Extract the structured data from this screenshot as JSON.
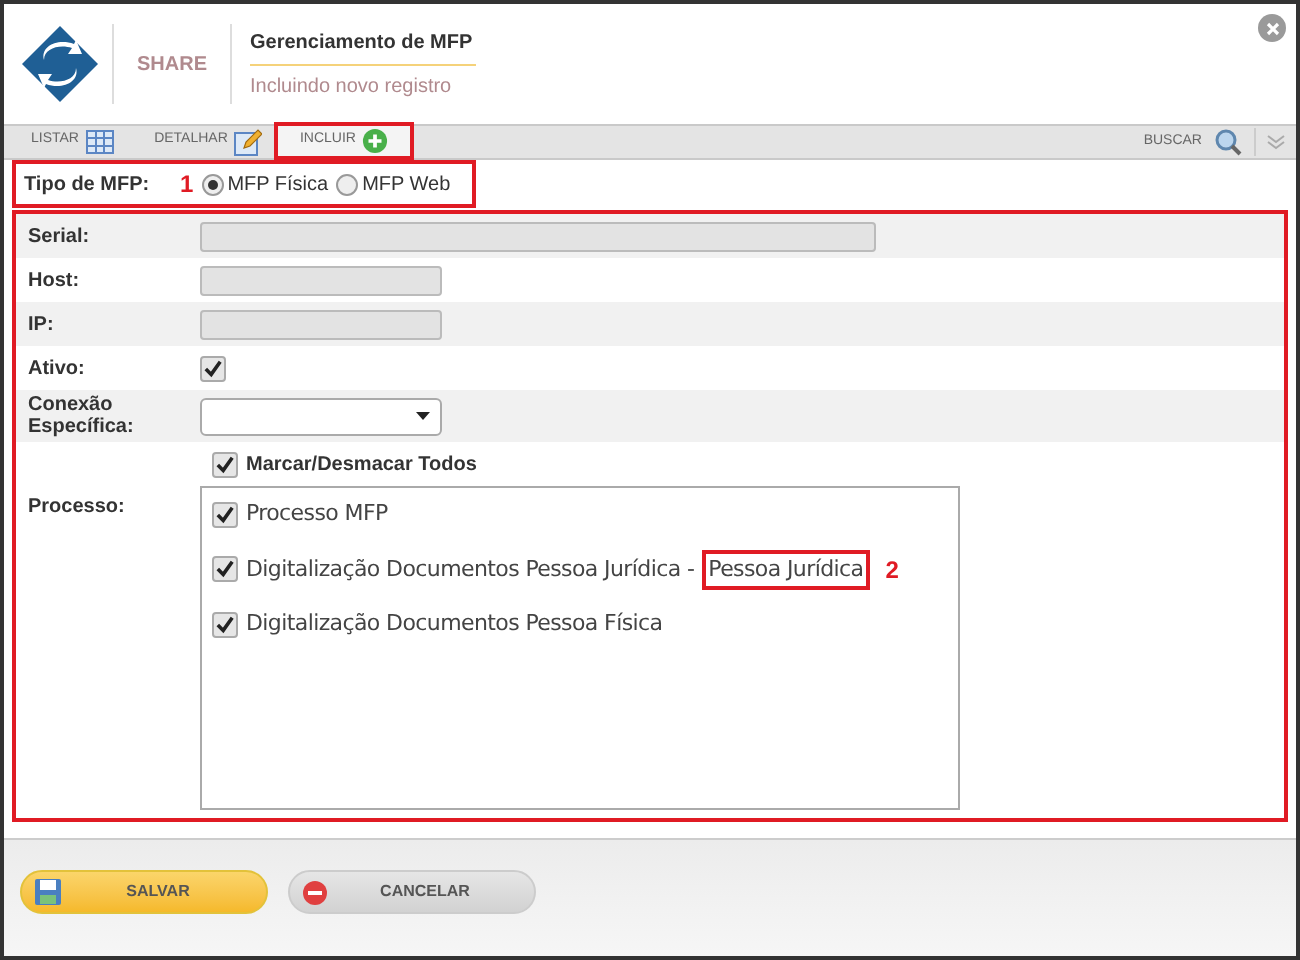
{
  "header": {
    "brand": "SHARE",
    "title": "Gerenciamento de MFP",
    "subtitle": "Incluindo novo registro"
  },
  "tabs": [
    {
      "label": "LISTAR",
      "selected": false
    },
    {
      "label": "DETALHAR",
      "selected": false
    },
    {
      "label": "INCLUIR",
      "selected": true
    }
  ],
  "search_label": "BUSCAR",
  "mfp_type": {
    "label": "Tipo de MFP:",
    "marker": "1",
    "options": [
      {
        "label": "MFP Física",
        "selected": true
      },
      {
        "label": "MFP Web",
        "selected": false
      }
    ]
  },
  "fields": [
    {
      "kind": "text",
      "label": "Serial:",
      "wide": true
    },
    {
      "kind": "text",
      "label": "Host:",
      "wide": false
    },
    {
      "kind": "text",
      "label": "IP:",
      "wide": false
    },
    {
      "kind": "checkbox",
      "label": "Ativo:",
      "checked": true
    },
    {
      "kind": "select",
      "label": "Conexão Específica:"
    }
  ],
  "select_all": {
    "label": "Marcar/Desmacar Todos",
    "checked": true
  },
  "process": {
    "label": "Processo:",
    "items": [
      {
        "label": "Processo MFP",
        "checked": true
      },
      {
        "label": "Digitalização Documentos Pessoa Jurídica -",
        "suffix": "Pessoa Jurídica",
        "marker": "2",
        "checked": true
      },
      {
        "label": "Digitalização Documentos Pessoa Física",
        "checked": true
      }
    ]
  },
  "buttons": [
    {
      "label": "SALVAR",
      "kind": "save"
    },
    {
      "label": "CANCELAR",
      "kind": "cancel"
    }
  ]
}
